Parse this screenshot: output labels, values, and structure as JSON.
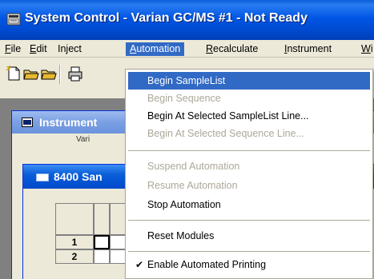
{
  "window": {
    "title": "System Control - Varian GC/MS #1 - Not Ready"
  },
  "menubar": {
    "items": [
      {
        "label": "File",
        "mnemonic": "F",
        "rest": "ile"
      },
      {
        "label": "Edit",
        "mnemonic": "E",
        "rest": "dit"
      },
      {
        "label": "Inject",
        "mnemonic": "",
        "rest": "Inject"
      },
      {
        "label": "Automation",
        "mnemonic": "A",
        "rest": "utomation"
      },
      {
        "label": "Recalculate",
        "mnemonic": "R",
        "rest": "ecalculate"
      },
      {
        "label": "Instrument",
        "mnemonic": "I",
        "rest": "nstrument"
      },
      {
        "label": "Wi",
        "mnemonic": "W",
        "rest": "i"
      }
    ]
  },
  "toolbar": {
    "icons": [
      "new-icon",
      "open-icon",
      "save-icon",
      "print-icon"
    ]
  },
  "instrument_window": {
    "title": "Instrument",
    "subtitle": "Vari"
  },
  "samplelist_window": {
    "title": "8400 San",
    "row_labels": [
      "1",
      "2"
    ]
  },
  "automation_menu": {
    "items": [
      {
        "label": "Begin SampleList",
        "state": "highlighted"
      },
      {
        "label": "Begin Sequence",
        "state": "disabled"
      },
      {
        "label": "Begin At Selected SampleList Line...",
        "state": "enabled"
      },
      {
        "label": "Begin At Selected Sequence Line...",
        "state": "disabled"
      },
      {
        "label": "Suspend Automation",
        "state": "disabled"
      },
      {
        "label": "Resume Automation",
        "state": "disabled"
      },
      {
        "label": "Stop Automation",
        "state": "enabled"
      },
      {
        "label": "Reset Modules",
        "state": "enabled"
      },
      {
        "label": "Enable Automated Printing",
        "state": "checked"
      }
    ]
  },
  "colors": {
    "titlebar": "#0055e5",
    "highlight": "#316ac5",
    "disabled_text": "#aca899",
    "face": "#ece9d8"
  }
}
